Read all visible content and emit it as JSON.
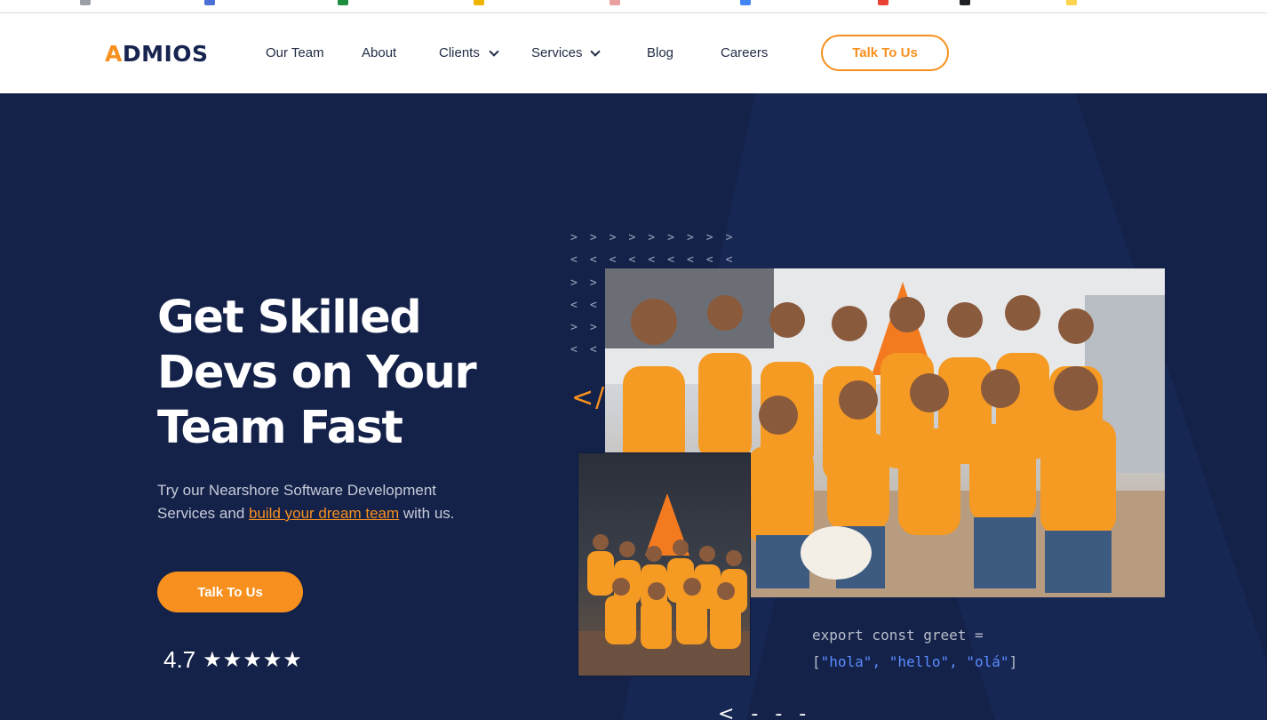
{
  "nav": {
    "logo": "ADMIOS",
    "items": [
      {
        "label": "Our Team"
      },
      {
        "label": "About"
      },
      {
        "label": "Clients"
      },
      {
        "label": "Services"
      },
      {
        "label": "Blog"
      },
      {
        "label": "Careers"
      }
    ],
    "cta": "Talk To Us"
  },
  "hero": {
    "headline": [
      "Get Skilled",
      "Devs on Your",
      "Team Fast"
    ],
    "sub_prefix": "Try our Nearshore Software Development Services and ",
    "sub_link": "build your dream team",
    "sub_suffix": " with us.",
    "cta": "Talk To Us",
    "rating_value": "4.7",
    "rating_stars": "★★★★★",
    "code_icon": "</>",
    "code_line1": "export const greet =",
    "code_open": "[",
    "code_strings": "\"hola\", \"hello\", \"olá\"",
    "code_close": "]",
    "dashes": "< - - -"
  },
  "colors": {
    "accent": "#f7901e",
    "navy": "#14224a",
    "code_string": "#5b8cff"
  },
  "icons": [
    "chevron-down-icon",
    "star-icon",
    "code-brackets-icon"
  ]
}
